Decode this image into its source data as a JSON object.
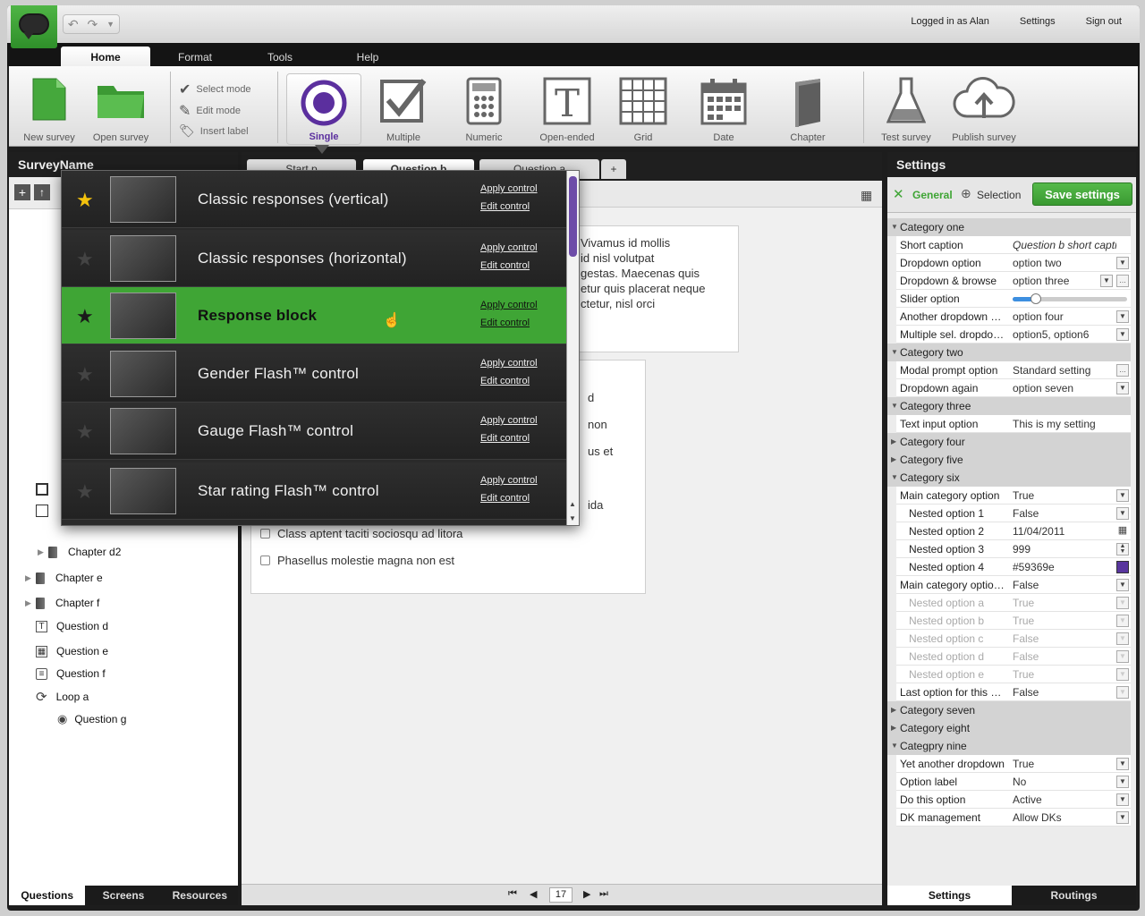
{
  "topbar": {
    "logged_in": "Logged in as Alan",
    "settings": "Settings",
    "sign_out": "Sign out"
  },
  "menu_tabs": [
    "Home",
    "Format",
    "Tools",
    "Help"
  ],
  "ribbon": {
    "new_survey": "New survey",
    "open_survey": "Open survey",
    "select_mode": "Select mode",
    "edit_mode": "Edit mode",
    "insert_label": "Insert label",
    "single": "Single",
    "multiple": "Multiple",
    "numeric": "Numeric",
    "open_ended": "Open-ended",
    "grid": "Grid",
    "date": "Date",
    "chapter": "Chapter",
    "test_survey": "Test survey",
    "publish_survey": "Publish survey"
  },
  "left": {
    "title": "SurveyName",
    "tree": [
      "Chapter d2",
      "Chapter e",
      "Chapter f",
      "Question d",
      "Question e",
      "Question f",
      "Loop a",
      "Question g"
    ],
    "tabs": [
      "Questions",
      "Screens",
      "Resources"
    ]
  },
  "center": {
    "tabs": [
      "Start p",
      "Question b",
      "Question a",
      "+"
    ],
    "text_lines": [
      "Vivamus id mollis",
      "id nisl volutpat",
      "gestas. Maecenas quis",
      "etur quis placerat neque",
      "ctetur, nisl orci"
    ],
    "partial_answers": [
      "d",
      "non",
      "us et",
      "ida"
    ],
    "answers": [
      "Class aptent taciti sociosqu ad litora",
      "Phasellus molestie magna non est"
    ],
    "page": "17"
  },
  "popup": {
    "apply": "Apply control",
    "edit": "Edit control",
    "items": [
      {
        "title": "Classic responses (vertical)",
        "starred": true,
        "selected": false
      },
      {
        "title": "Classic responses (horizontal)",
        "starred": false,
        "selected": false
      },
      {
        "title": "Response block",
        "starred": false,
        "selected": true
      },
      {
        "title": "Gender Flash™ control",
        "starred": false,
        "selected": false
      },
      {
        "title": "Gauge Flash™ control",
        "starred": false,
        "selected": false
      },
      {
        "title": "Star rating Flash™ control",
        "starred": false,
        "selected": false
      }
    ]
  },
  "settings": {
    "title": "Settings",
    "general": "General",
    "selection": "Selection",
    "save": "Save settings",
    "tabs": [
      "Settings",
      "Routings"
    ],
    "slider_option": 0.2,
    "color_swatch": "#59369e",
    "cat_one": "Category one",
    "short_caption_k": "Short caption",
    "short_caption_v": "Question b short caption",
    "dropdown_option_k": "Dropdown option",
    "dropdown_option_v": "option two",
    "dropdown_browse_k": "Dropdown & browse",
    "dropdown_browse_v": "option three",
    "slider_option_k": "Slider option",
    "another_dropdown_k": "Another dropdown wi...",
    "another_dropdown_v": "option four",
    "multiple_sel_k": "Multiple sel. dropdown",
    "multiple_sel_v": "option5, option6",
    "cat_two": "Category two",
    "modal_prompt_k": "Modal prompt option",
    "modal_prompt_v": "Standard setting",
    "dropdown_again_k": "Dropdown again",
    "dropdown_again_v": "option seven",
    "cat_three": "Category three",
    "text_input_k": "Text input option",
    "text_input_v": "This is my setting",
    "cat_four": "Category four",
    "cat_five": "Category five",
    "cat_six": "Category six",
    "main_cat_k": "Main category option",
    "main_cat_v": "True",
    "n1_k": "Nested option 1",
    "n1_v": "False",
    "n2_k": "Nested option 2",
    "n2_v": "11/04/2011",
    "n3_k": "Nested option 3",
    "n3_v": "999",
    "n4_k": "Nested option 4",
    "n4_v": "#59369e",
    "main_cat2_k": "Main category option 2",
    "main_cat2_v": "False",
    "na_k": "Nested option a",
    "na_v": "True",
    "nb_k": "Nested option b",
    "nb_v": "True",
    "nc_k": "Nested option c",
    "nc_v": "False",
    "nd_k": "Nested option d",
    "nd_v": "False",
    "ne_k": "Nested option e",
    "ne_v": "True",
    "last_k": "Last option for this gr...",
    "last_v": "False",
    "cat_seven": "Category seven",
    "cat_eight": "Category eight",
    "cat_nine": "Categpry nine",
    "yet_k": "Yet another dropdown",
    "yet_v": "True",
    "optlabel_k": "Option label",
    "optlabel_v": "No",
    "dothis_k": "Do this option",
    "dothis_v": "Active",
    "dk_k": "DK management",
    "dk_v": "Allow DKs"
  }
}
